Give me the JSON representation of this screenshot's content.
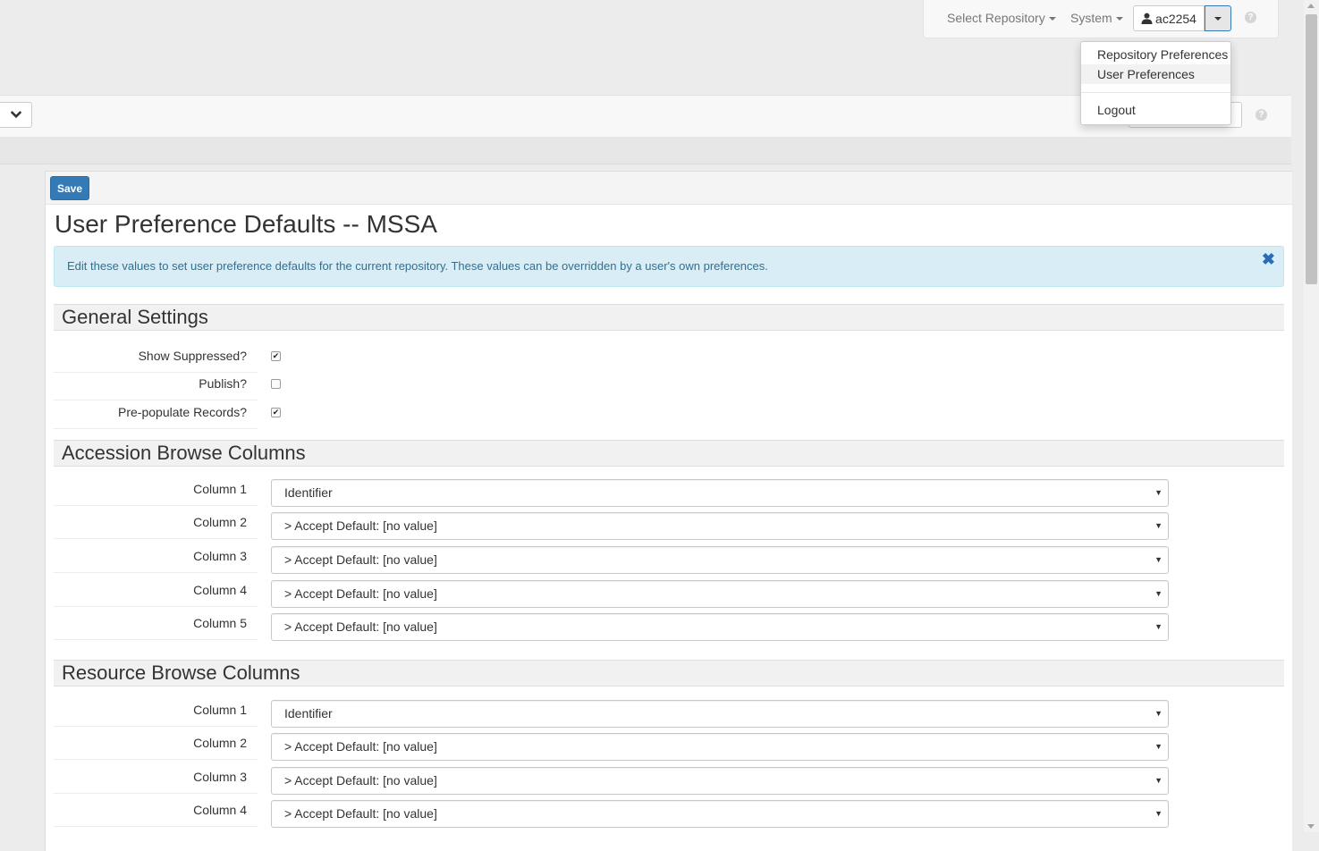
{
  "topnav": {
    "select_repository": "Select Repository",
    "system": "System",
    "user": "ac2254",
    "help": "?"
  },
  "user_menu": {
    "items": [
      "Repository Preferences",
      "User Preferences",
      "Logout"
    ],
    "active": "User Preferences"
  },
  "toolbar": {
    "help": "?"
  },
  "page": {
    "save_label": "Save",
    "title": "User Preference Defaults -- MSSA",
    "info": "Edit these values to set user preference defaults for the current repository. These values can be overridden by a user's own preferences.",
    "info_close": "✖"
  },
  "general": {
    "heading": "General Settings",
    "fields": [
      {
        "label": "Show Suppressed?",
        "checked": true,
        "mark": "✔"
      },
      {
        "label": "Publish?",
        "checked": false,
        "mark": ""
      },
      {
        "label": "Pre-populate Records?",
        "checked": true,
        "mark": "✔"
      }
    ]
  },
  "accession": {
    "heading": "Accession Browse Columns",
    "columns": [
      {
        "label": "Column 1",
        "value": "Identifier"
      },
      {
        "label": "Column 2",
        "value": "> Accept Default: [no value]"
      },
      {
        "label": "Column 3",
        "value": "> Accept Default: [no value]"
      },
      {
        "label": "Column 4",
        "value": "> Accept Default: [no value]"
      },
      {
        "label": "Column 5",
        "value": "> Accept Default: [no value]"
      }
    ]
  },
  "resource": {
    "heading": "Resource Browse Columns",
    "columns": [
      {
        "label": "Column 1",
        "value": "Identifier"
      },
      {
        "label": "Column 2",
        "value": "> Accept Default: [no value]"
      },
      {
        "label": "Column 3",
        "value": "> Accept Default: [no value]"
      },
      {
        "label": "Column 4",
        "value": "> Accept Default: [no value]"
      }
    ]
  },
  "colors": {
    "primary": "#337ab7",
    "info_bg": "#d9edf7",
    "info_text": "#31708f"
  }
}
